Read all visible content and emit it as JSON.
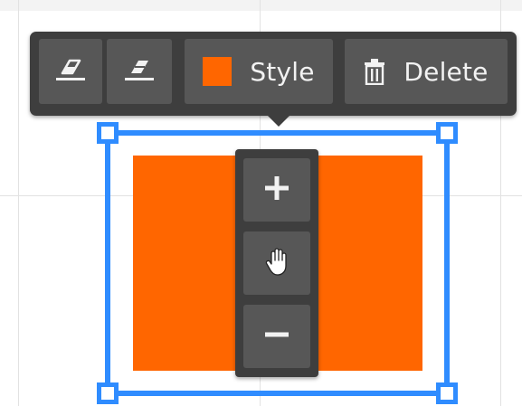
{
  "toolbar": {
    "style_label": "Style",
    "delete_label": "Delete",
    "style_swatch_color": "#ff6600"
  },
  "selection": {
    "color": "#2f8cff"
  },
  "shape": {
    "fill": "#ff6600"
  },
  "icons": {
    "eraser_1": "eraser-icon",
    "eraser_2": "eraser-filled-icon",
    "trash": "trash-icon",
    "zoom_in": "plus-icon",
    "pan": "hand-icon",
    "zoom_out": "minus-icon"
  }
}
